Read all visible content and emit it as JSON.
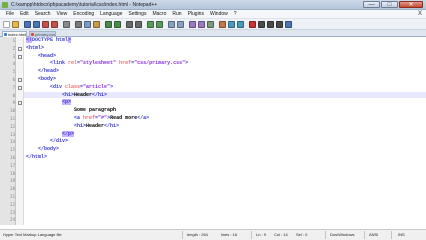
{
  "window": {
    "title": "C:\\xampp\\htdocs\\phpacademy\\tutorial\\css\\index.html - Notepad++",
    "minimize_glyph": "—",
    "maximize_glyph": "□",
    "close_glyph": "✕"
  },
  "menu": {
    "items": [
      "File",
      "Edit",
      "Search",
      "View",
      "Encoding",
      "Language",
      "Settings",
      "Macro",
      "Run",
      "Plugins",
      "Window",
      "?"
    ],
    "close_glyph": "X"
  },
  "toolbar": {
    "icons": [
      {
        "name": "new-file-icon",
        "color": "#ffffff"
      },
      {
        "name": "open-file-icon",
        "color": "#e8b84a"
      },
      {
        "name": "save-icon",
        "color": "#4a76b8"
      },
      {
        "name": "save-all-icon",
        "color": "#4a76b8"
      },
      {
        "name": "close-icon",
        "color": "#c8504a"
      },
      {
        "name": "close-all-icon",
        "color": "#c8504a"
      },
      {
        "name": "print-icon",
        "color": "#8a8a8a"
      },
      {
        "name": "cut-icon",
        "color": "#7a7a7a"
      },
      {
        "name": "copy-icon",
        "color": "#7a9ac8"
      },
      {
        "name": "paste-icon",
        "color": "#c89a4a"
      },
      {
        "name": "undo-icon",
        "color": "#4a8a4a"
      },
      {
        "name": "redo-icon",
        "color": "#4a8a4a"
      },
      {
        "name": "find-icon",
        "color": "#6a6a6a"
      },
      {
        "name": "replace-icon",
        "color": "#6a6a6a"
      },
      {
        "name": "zoom-in-icon",
        "color": "#5a9a5a"
      },
      {
        "name": "zoom-out-icon",
        "color": "#5a9a5a"
      },
      {
        "name": "sync-vertical-icon",
        "color": "#8aa0c0"
      },
      {
        "name": "sync-horizontal-icon",
        "color": "#8aa0c0"
      },
      {
        "name": "word-wrap-icon",
        "color": "#9a7ac0"
      },
      {
        "name": "show-all-chars-icon",
        "color": "#9a7ac0"
      },
      {
        "name": "indent-guide-icon",
        "color": "#7a9a7a"
      },
      {
        "name": "lang-define-icon",
        "color": "#c07a4a"
      },
      {
        "name": "doc-map-icon",
        "color": "#4a9ac0"
      },
      {
        "name": "function-list-icon",
        "color": "#4a9ac0"
      },
      {
        "name": "record-macro-icon",
        "color": "#c83232"
      },
      {
        "name": "stop-record-icon",
        "color": "#4a4a4a"
      },
      {
        "name": "play-macro-icon",
        "color": "#4a4a4a"
      },
      {
        "name": "run-macro-multiple-icon",
        "color": "#4a4a4a"
      },
      {
        "name": "save-macro-icon",
        "color": "#4a76b8"
      }
    ]
  },
  "tabs": [
    {
      "label": "index.html",
      "dot_color": "#2f7fd8"
    },
    {
      "label": "primary.css",
      "dot_color": "#d84a3a"
    }
  ],
  "editor": {
    "current_line": 8,
    "lines": [
      {
        "num": "1",
        "fold": "",
        "segments": [
          {
            "t": "",
            "c": ""
          },
          {
            "t": "<!",
            "c": "ck hl"
          },
          {
            "t": "DOCTYPE html",
            "c": "ck"
          },
          {
            "t": ">",
            "c": "ck hl"
          }
        ]
      },
      {
        "num": "2",
        "fold": "-",
        "segments": [
          {
            "t": "<html>",
            "c": "ck"
          }
        ]
      },
      {
        "num": "3",
        "fold": "-",
        "segments": [
          {
            "t": "    <head>",
            "c": "ck"
          }
        ]
      },
      {
        "num": "4",
        "fold": "",
        "segments": [
          {
            "t": "        <link ",
            "c": "ck"
          },
          {
            "t": "rel",
            "c": "ca"
          },
          {
            "t": "=",
            "c": "ck"
          },
          {
            "t": "\"stylesheet\"",
            "c": "cs"
          },
          {
            "t": " href",
            "c": "ca"
          },
          {
            "t": "=",
            "c": "ck"
          },
          {
            "t": "\"css/primary.css\"",
            "c": "cs"
          },
          {
            "t": ">",
            "c": "ck"
          }
        ]
      },
      {
        "num": "5",
        "fold": "",
        "segments": [
          {
            "t": "    </head>",
            "c": "ck"
          }
        ]
      },
      {
        "num": "6",
        "fold": "-",
        "segments": [
          {
            "t": "    <body>",
            "c": "ck"
          }
        ]
      },
      {
        "num": "7",
        "fold": "-",
        "segments": [
          {
            "t": "        <div ",
            "c": "ck"
          },
          {
            "t": "class",
            "c": "ca"
          },
          {
            "t": "=",
            "c": "ck"
          },
          {
            "t": "\"article\"",
            "c": "cs"
          },
          {
            "t": ">",
            "c": "ck"
          }
        ]
      },
      {
        "num": "8",
        "fold": "",
        "segments": [
          {
            "t": "            <h1>",
            "c": "ck"
          },
          {
            "t": "Header",
            "c": "ct"
          },
          {
            "t": "</h1>",
            "c": "ck"
          }
        ]
      },
      {
        "num": "9",
        "fold": "-",
        "segments": [
          {
            "t": "            ",
            "c": ""
          },
          {
            "t": "<p>",
            "c": "ck hl"
          }
        ]
      },
      {
        "num": "10",
        "fold": "",
        "segments": [
          {
            "t": "                Some paragraph",
            "c": "ct"
          }
        ]
      },
      {
        "num": "11",
        "fold": "",
        "segments": [
          {
            "t": "                <a ",
            "c": "ck"
          },
          {
            "t": "href",
            "c": "ca"
          },
          {
            "t": "=",
            "c": "ck"
          },
          {
            "t": "\"#\"",
            "c": "cs"
          },
          {
            "t": ">",
            "c": "ck"
          },
          {
            "t": "Read more",
            "c": "ct"
          },
          {
            "t": "</a>",
            "c": "ck"
          }
        ]
      },
      {
        "num": "12",
        "fold": "",
        "segments": [
          {
            "t": "                <h1>",
            "c": "ck"
          },
          {
            "t": "Header",
            "c": "ct"
          },
          {
            "t": "</h1>",
            "c": "ck"
          }
        ]
      },
      {
        "num": "13",
        "fold": "",
        "segments": [
          {
            "t": "            ",
            "c": ""
          },
          {
            "t": "</p>",
            "c": "ck hl"
          }
        ]
      },
      {
        "num": "14",
        "fold": "",
        "segments": [
          {
            "t": "        </div>",
            "c": "ck"
          }
        ]
      },
      {
        "num": "15",
        "fold": "",
        "segments": [
          {
            "t": "    </body>",
            "c": "ck"
          }
        ]
      },
      {
        "num": "16",
        "fold": "",
        "segments": [
          {
            "t": "</html>",
            "c": "ck"
          }
        ]
      },
      {
        "num": "17",
        "fold": "",
        "segments": []
      },
      {
        "num": "18",
        "fold": "",
        "segments": []
      },
      {
        "num": "19",
        "fold": "",
        "segments": []
      },
      {
        "num": "20",
        "fold": "",
        "segments": []
      },
      {
        "num": "21",
        "fold": "",
        "segments": []
      },
      {
        "num": "22",
        "fold": "",
        "segments": []
      },
      {
        "num": "23",
        "fold": "",
        "segments": []
      },
      {
        "num": "24",
        "fold": "",
        "segments": []
      }
    ]
  },
  "status": {
    "language": "Hyper Text Markup Language file",
    "length": "length : 264",
    "lines": "lines : 16",
    "ln": "Ln : 9",
    "col": "Col : 14",
    "sel": "Sel : 0",
    "eol": "Dos\\Windows",
    "encoding": "ANSI",
    "mode": "INS"
  }
}
